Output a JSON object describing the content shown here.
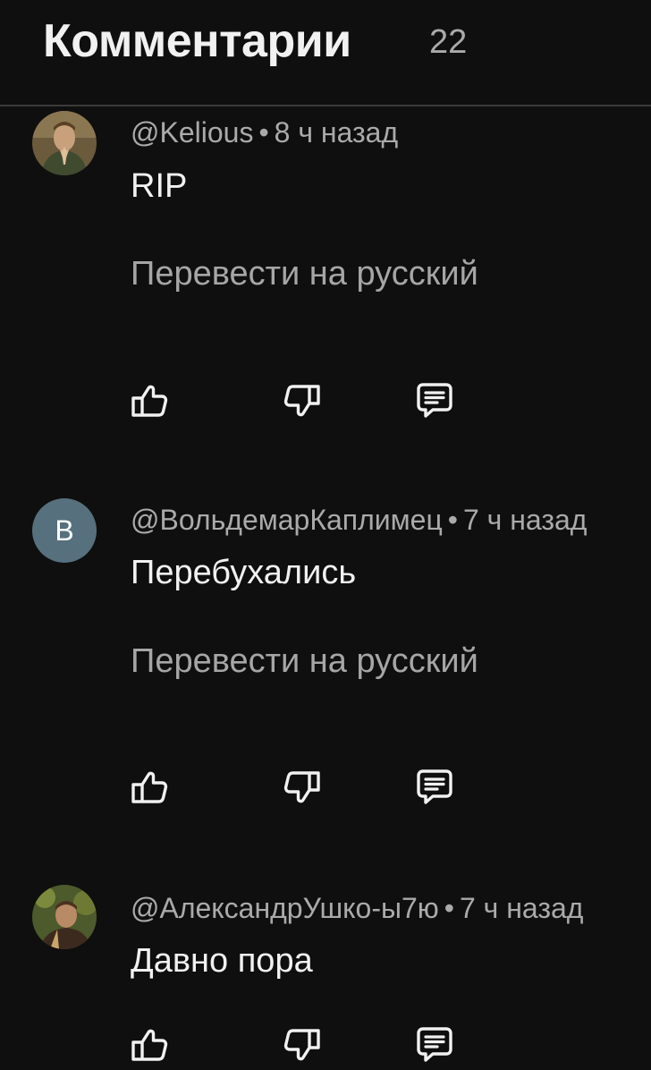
{
  "header": {
    "title": "Комментарии",
    "count": "22"
  },
  "comments": [
    {
      "author": "@Kelious",
      "separator": "•",
      "time": "8 ч назад",
      "text": "RIP",
      "translate_label": "Перевести на русский",
      "avatar": "photo-avatar"
    },
    {
      "author": "@ВольдемарКаплимец",
      "separator": "•",
      "time": "7 ч назад",
      "text": "Перебухались",
      "translate_label": "Перевести на русский",
      "avatar_letter": "В",
      "avatar_color": "#56707e"
    },
    {
      "author": "@АлександрУшко-ы7ю",
      "separator": "•",
      "time": "7 ч назад",
      "text": "Давно пора",
      "avatar": "photo-avatar"
    }
  ],
  "icons": {
    "like": "thumbs-up-icon",
    "dislike": "thumbs-down-icon",
    "reply": "reply-comment-icon"
  },
  "colors": {
    "background": "#0f0f0f",
    "primary_text": "#f1f1f1",
    "secondary_text": "#aaaaaa",
    "divider": "#3a3a3a"
  }
}
